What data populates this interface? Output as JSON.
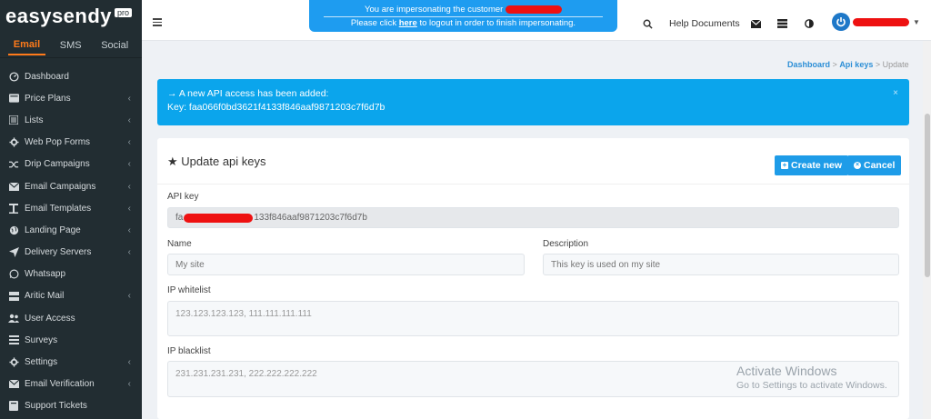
{
  "brand": {
    "name": "easysendy",
    "badge": "pro"
  },
  "channel_tabs": [
    "Email",
    "SMS",
    "Social"
  ],
  "menu": [
    {
      "label": "Dashboard",
      "icon": "dashboard-icon",
      "chevron": false
    },
    {
      "label": "Price Plans",
      "icon": "price-icon",
      "chevron": true
    },
    {
      "label": "Lists",
      "icon": "list-icon",
      "chevron": true
    },
    {
      "label": "Web Pop Forms",
      "icon": "gear-icon",
      "chevron": true
    },
    {
      "label": "Drip Campaigns",
      "icon": "shuffle-icon",
      "chevron": true
    },
    {
      "label": "Email Campaigns",
      "icon": "envelope-icon",
      "chevron": true
    },
    {
      "label": "Email Templates",
      "icon": "template-icon",
      "chevron": true
    },
    {
      "label": "Landing Page",
      "icon": "globe-icon",
      "chevron": true
    },
    {
      "label": "Delivery Servers",
      "icon": "send-icon",
      "chevron": true
    },
    {
      "label": "Whatsapp",
      "icon": "whatsapp-icon",
      "chevron": false
    },
    {
      "label": "Aritic Mail",
      "icon": "server-icon",
      "chevron": true
    },
    {
      "label": "User Access",
      "icon": "users-icon",
      "chevron": false
    },
    {
      "label": "Surveys",
      "icon": "bars-icon",
      "chevron": false
    },
    {
      "label": "Settings",
      "icon": "gear-icon",
      "chevron": true
    },
    {
      "label": "Email Verification",
      "icon": "envelope-check-icon",
      "chevron": true
    },
    {
      "label": "Support Tickets",
      "icon": "ticket-icon",
      "chevron": false
    }
  ],
  "header": {
    "impersonation": {
      "line1": "You are impersonating the customer",
      "line2_prefix": "Please click",
      "link": "here",
      "line2_suffix": "to logout in order to finish impersonating."
    },
    "help_label": "Help Documents"
  },
  "breadcrumb": {
    "items": [
      "Dashboard",
      "Api keys",
      "Update"
    ],
    "separator": ">"
  },
  "alert": {
    "line1": "→ A new API access has been added:",
    "line2": "Key: faa066f0bd3621f4133f846aaf9871203c7f6d7b",
    "close": "×"
  },
  "form": {
    "title": "Update api keys",
    "create_button": "Create new",
    "cancel_button": "Cancel",
    "api_key_label": "API key",
    "api_key_prefix": "fa",
    "api_key_suffix": "133f846aaf9871203c7f6d7b",
    "name_label": "Name",
    "name_placeholder": "My site",
    "description_label": "Description",
    "description_placeholder": "This key is used on my site",
    "whitelist_label": "IP whitelist",
    "whitelist_placeholder": "123.123.123.123, 111.111.111.111",
    "blacklist_label": "IP blacklist",
    "blacklist_placeholder": "231.231.231.231, 222.222.222.222"
  },
  "watermark": {
    "line1": "Activate Windows",
    "line2": "Go to Settings to activate Windows."
  },
  "colors": {
    "sidebar": "#222d32",
    "accent": "#ff7a1a",
    "primary": "#1e9ce8",
    "alert": "#0ba5ec",
    "redaction": "#ee1111"
  }
}
